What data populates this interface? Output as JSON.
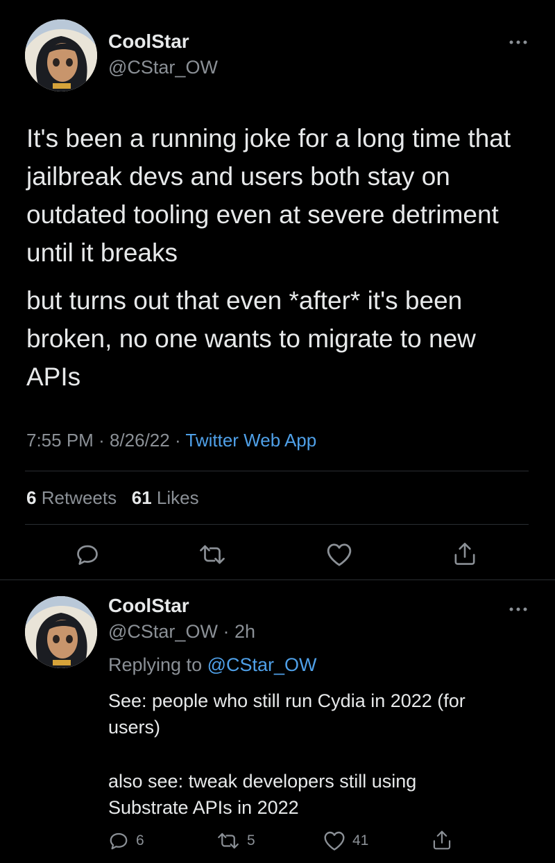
{
  "main_tweet": {
    "author_name": "CoolStar",
    "author_handle": "@CStar_OW",
    "more_icon": "ellipsis-icon",
    "paragraph_1": "It's been a running joke for a long time that jailbreak devs and users both stay on outdated tooling even at severe detriment until it breaks",
    "paragraph_2": "but turns out that even *after* it's been broken, no one wants to migrate to new APIs",
    "time": "7:55 PM",
    "date": "8/26/22",
    "source": "Twitter Web App",
    "separator": "·",
    "retweet_count": "6",
    "retweet_label": "Retweets",
    "like_count": "61",
    "like_label": "Likes",
    "actions": [
      "reply-icon",
      "retweet-icon",
      "heart-icon",
      "share-icon"
    ]
  },
  "reply_tweet": {
    "author_name": "CoolStar",
    "author_handle": "@CStar_OW",
    "age": "2h",
    "separator": "·",
    "replying_prefix": "Replying to",
    "replying_handle": "@CStar_OW",
    "line_1": "See: people who still run Cydia in 2022 (for users)",
    "line_2": "also see: tweak developers still using Substrate APIs in 2022",
    "reply_count": "6",
    "retweet_count": "5",
    "like_count": "41"
  },
  "colors": {
    "background": "#000000",
    "text": "#e7e9ea",
    "secondary": "#8b9096",
    "link": "#4fa0e8",
    "divider": "#2a2e33"
  }
}
